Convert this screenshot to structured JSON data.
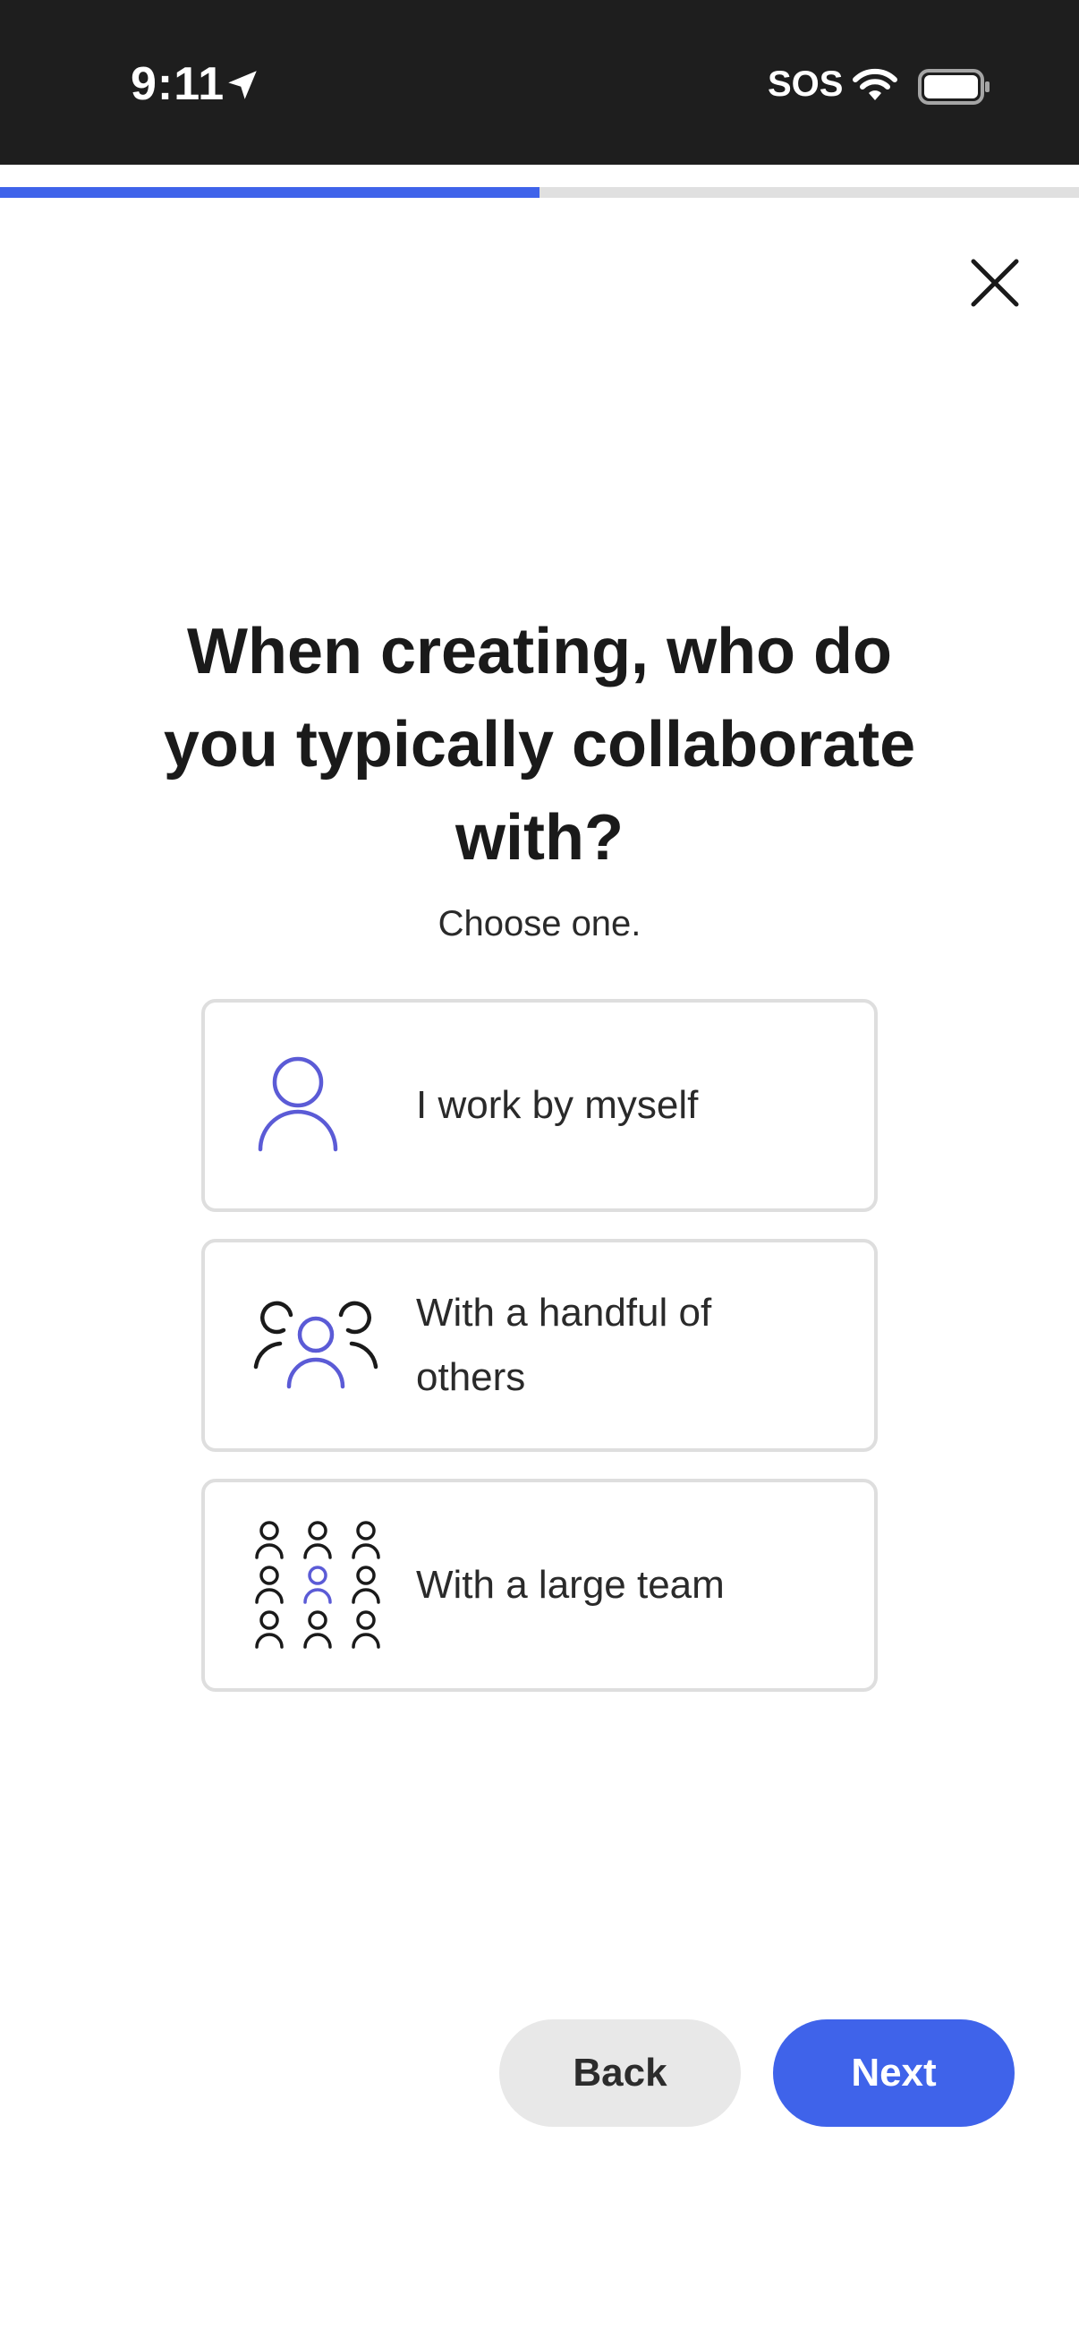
{
  "status_bar": {
    "time": "9:11",
    "carrier": "SOS"
  },
  "progress": {
    "fraction": 0.5
  },
  "title": "When creating, who do you typically collaborate with?",
  "subtitle": "Choose one.",
  "options": [
    {
      "label": "I work by myself",
      "icon": "single-person-icon"
    },
    {
      "label": "With a handful of others",
      "icon": "small-group-icon"
    },
    {
      "label": "With a large team",
      "icon": "large-team-icon"
    }
  ],
  "buttons": {
    "back": "Back",
    "next": "Next"
  },
  "colors": {
    "accent": "#3f63ea",
    "icon_accent": "#5b5bd6",
    "status_bar": "#1e1e1e"
  }
}
